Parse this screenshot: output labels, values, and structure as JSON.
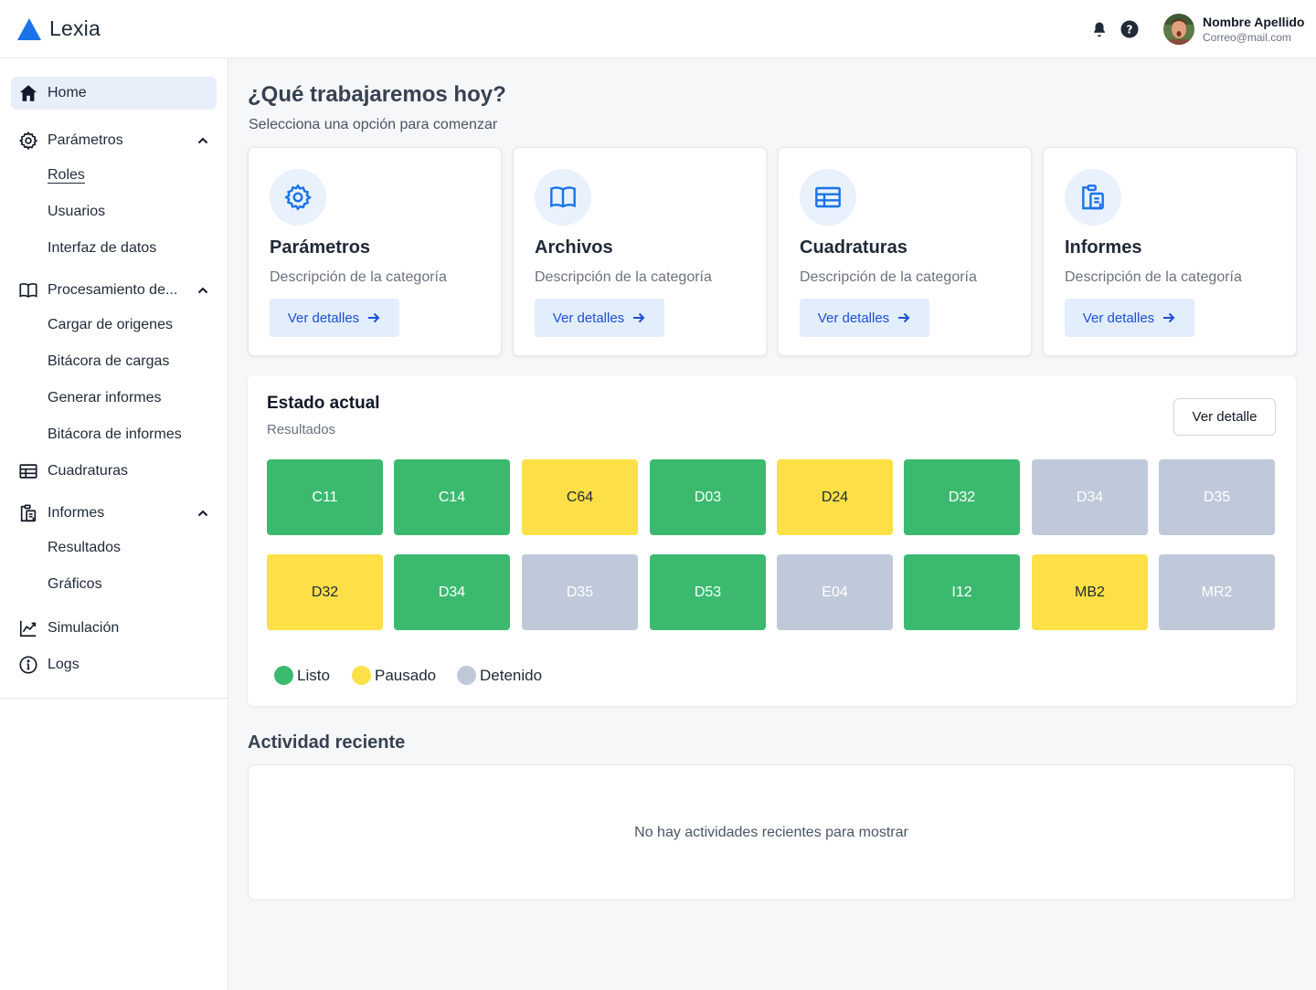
{
  "app": {
    "name": "Lexia"
  },
  "user": {
    "name": "Nombre Apellido",
    "email": "Correo@mail.com"
  },
  "sidebar": {
    "home": "Home",
    "parametros": {
      "label": "Parámetros",
      "children": [
        "Roles",
        "Usuarios",
        "Interfaz de datos"
      ]
    },
    "procesamiento": {
      "label": "Procesamiento de...",
      "children": [
        "Cargar de origenes",
        "Bitácora de cargas",
        "Generar informes",
        "Bitácora de informes"
      ]
    },
    "cuadraturas": "Cuadraturas",
    "informes": {
      "label": "Informes",
      "children": [
        "Resultados",
        "Gráficos"
      ]
    },
    "simulacion": "Simulación",
    "logs": "Logs"
  },
  "main": {
    "title": "¿Qué trabajaremos hoy?",
    "subtitle": "Selecciona una opción para comenzar",
    "cards": [
      {
        "title": "Parámetros",
        "description": "Descripción de la categoría",
        "button": "Ver detalles",
        "icon": "gear-icon"
      },
      {
        "title": "Archivos",
        "description": "Descripción de la categoría",
        "button": "Ver detalles",
        "icon": "book-icon"
      },
      {
        "title": "Cuadraturas",
        "description": "Descripción de la categoría",
        "button": "Ver detalles",
        "icon": "table-icon"
      },
      {
        "title": "Informes",
        "description": "Descripción de la categoría",
        "button": "Ver detalles",
        "icon": "clipboard-icon"
      }
    ]
  },
  "status": {
    "title": "Estado actual",
    "subtitle": "Resultados",
    "button": "Ver detalle",
    "tiles": [
      {
        "code": "C11",
        "state": "listo"
      },
      {
        "code": "C14",
        "state": "listo"
      },
      {
        "code": "C64",
        "state": "pausado"
      },
      {
        "code": "D03",
        "state": "listo"
      },
      {
        "code": "D24",
        "state": "pausado"
      },
      {
        "code": "D32",
        "state": "listo"
      },
      {
        "code": "D34",
        "state": "detenido"
      },
      {
        "code": "D35",
        "state": "detenido"
      },
      {
        "code": "D32",
        "state": "pausado"
      },
      {
        "code": "D34",
        "state": "listo"
      },
      {
        "code": "D35",
        "state": "detenido"
      },
      {
        "code": "D53",
        "state": "listo"
      },
      {
        "code": "E04",
        "state": "detenido"
      },
      {
        "code": "I12",
        "state": "listo"
      },
      {
        "code": "MB2",
        "state": "pausado"
      },
      {
        "code": "MR2",
        "state": "detenido"
      }
    ],
    "legend": [
      {
        "label": "Listo",
        "color": "#3bba6f"
      },
      {
        "label": "Pausado",
        "color": "#fde047"
      },
      {
        "label": "Detenido",
        "color": "#bfc9d9"
      }
    ]
  },
  "activity": {
    "title": "Actividad reciente",
    "empty": "No hay actividades recientes para mostrar"
  },
  "colors": {
    "accent": "#1a73e8",
    "listo": "#3bba6f",
    "pausado": "#fde047",
    "detenido": "#bfc9d9"
  }
}
